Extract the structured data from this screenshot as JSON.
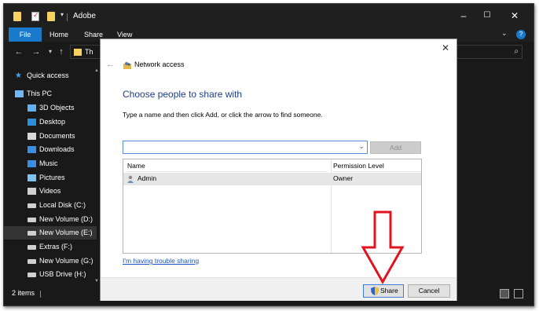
{
  "window": {
    "title": "Adobe",
    "ribbon_tabs": [
      "File",
      "Home",
      "Share",
      "View"
    ],
    "address_text": "Th",
    "help_label": "?",
    "controls": {
      "minimize": "–",
      "maximize": "☐",
      "close": "✕"
    }
  },
  "nav": {
    "items": [
      {
        "label": "Quick access",
        "icon": "star-icon",
        "color": "#4aa3f0"
      },
      {
        "label": "This PC",
        "icon": "computer-icon",
        "color": "#6fb8f5"
      },
      {
        "label": "3D Objects",
        "icon": "cube-icon",
        "color": "#62b0ef"
      },
      {
        "label": "Desktop",
        "icon": "desktop-icon",
        "color": "#2d8ee0"
      },
      {
        "label": "Documents",
        "icon": "document-icon",
        "color": "#d8d8d8"
      },
      {
        "label": "Downloads",
        "icon": "download-icon",
        "color": "#3b8de3"
      },
      {
        "label": "Music",
        "icon": "music-icon",
        "color": "#3b8de3"
      },
      {
        "label": "Pictures",
        "icon": "picture-icon",
        "color": "#7ec3ef"
      },
      {
        "label": "Videos",
        "icon": "video-icon",
        "color": "#cfcfcf"
      },
      {
        "label": "Local Disk (C:)",
        "icon": "drive-icon",
        "color": "#cfcfcf"
      },
      {
        "label": "New Volume (D:)",
        "icon": "drive-icon",
        "color": "#cfcfcf"
      },
      {
        "label": "New Volume (E:)",
        "icon": "drive-icon",
        "color": "#cfcfcf"
      },
      {
        "label": "Extras (F:)",
        "icon": "drive-icon",
        "color": "#cfcfcf"
      },
      {
        "label": "New Volume (G:)",
        "icon": "drive-icon",
        "color": "#cfcfcf"
      },
      {
        "label": "USB Drive (H:)",
        "icon": "drive-icon",
        "color": "#cfcfcf"
      }
    ],
    "selected_index": 11
  },
  "status": {
    "item_count": "2 items"
  },
  "dialog": {
    "title": "Network access",
    "heading": "Choose people to share with",
    "instruction": "Type a name and then click Add, or click the arrow to find someone.",
    "input_value": "",
    "add_label": "Add",
    "columns": [
      "Name",
      "Permission Level"
    ],
    "rows": [
      {
        "name": "Admin",
        "permission": "Owner"
      }
    ],
    "trouble_link": "I'm having trouble sharing",
    "share_label": "Share",
    "cancel_label": "Cancel",
    "close_label": "✕"
  },
  "colors": {
    "accent": "#1979ca",
    "heading": "#1e3e8a",
    "link": "#1a56c8",
    "annotation": "#e0141e"
  }
}
